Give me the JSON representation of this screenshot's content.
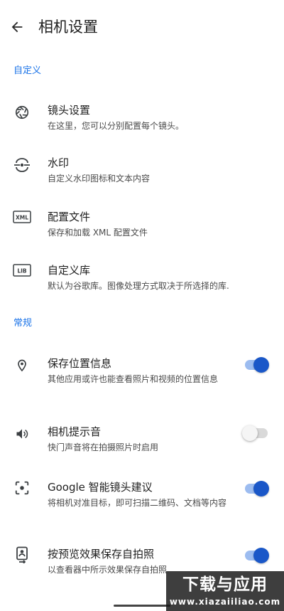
{
  "header": {
    "title": "相机设置",
    "back_icon": "arrow-back-icon"
  },
  "sections": {
    "custom": {
      "label": "自定义"
    },
    "general": {
      "label": "常规"
    }
  },
  "items": {
    "lens": {
      "title": "镜头设置",
      "summary": "在这里，您可以分别配置每个镜头。",
      "icon": "aperture-icon"
    },
    "watermark": {
      "title": "水印",
      "summary": "自定义水印图标和文本内容",
      "icon": "watermark-icon"
    },
    "config": {
      "title": "配置文件",
      "summary": "保存和加载 XML 配置文件",
      "icon": "xml-icon",
      "icon_text": "XML"
    },
    "library": {
      "title": "自定义库",
      "summary": "默认为谷歌库。图像处理方式取决于所选择的库.",
      "icon": "lib-icon",
      "icon_text": "LIB"
    },
    "location": {
      "title": "保存位置信息",
      "summary": "其他应用或许也能查看照片和视频的位置信息",
      "icon": "location-pin-icon",
      "switch_on": true
    },
    "shutter_sound": {
      "title": "相机提示音",
      "summary": "快门声音将在拍摄照片时启用",
      "icon": "volume-icon",
      "switch_on": false
    },
    "lens_suggestions": {
      "title": "Google 智能镜头建议",
      "summary": "将相机对准目标，即可扫描二维码、文档等内容",
      "icon": "lens-scan-icon",
      "switch_on": true
    },
    "selfie_preview": {
      "title": "按预览效果保存自拍照",
      "summary": "以查看器中所示效果保存自拍照",
      "icon": "selfie-icon",
      "switch_on": true
    }
  },
  "watermark_overlay": {
    "main": "下载与应用",
    "sub": "www.xiazaiiliao.com"
  },
  "colors": {
    "accent": "#1a73e8",
    "switch_on_thumb": "#1a57c8",
    "switch_on_track": "#9cbcf0",
    "switch_off_track": "#d9d9d9"
  }
}
